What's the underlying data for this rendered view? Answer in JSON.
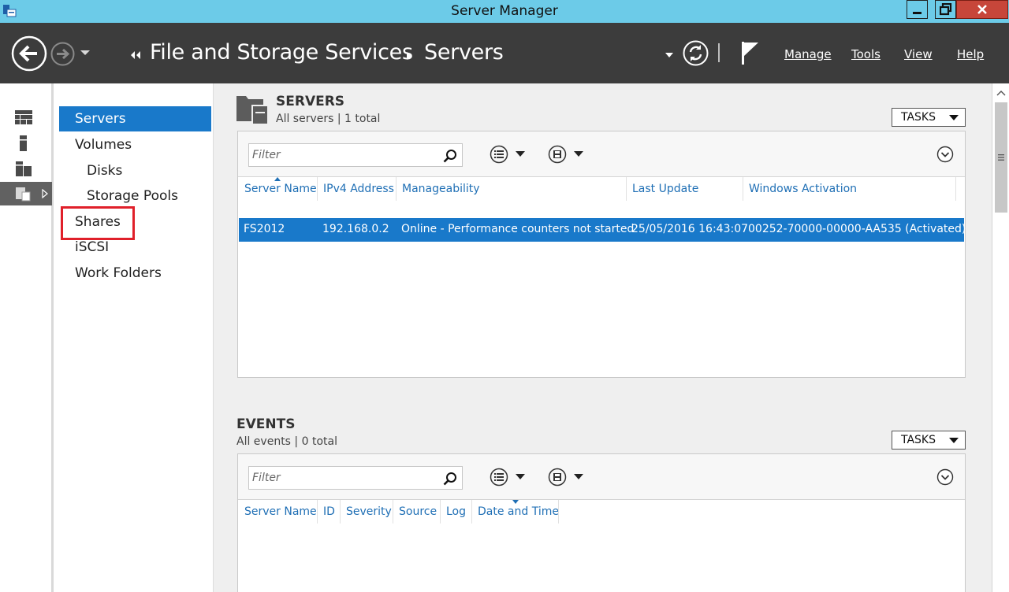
{
  "window": {
    "title": "Server Manager",
    "controls": {
      "minimize": "minimize",
      "maximize": "restore",
      "close": "close"
    }
  },
  "header": {
    "breadcrumb": [
      "File and Storage Services",
      "Servers"
    ],
    "menus": [
      {
        "label": "Manage"
      },
      {
        "label": "Tools"
      },
      {
        "label": "View"
      },
      {
        "label": "Help"
      }
    ]
  },
  "strip": {
    "items": [
      {
        "icon": "dashboard-icon"
      },
      {
        "icon": "local-server-icon"
      },
      {
        "icon": "all-servers-icon"
      },
      {
        "icon": "file-storage-icon",
        "active": true
      }
    ]
  },
  "nav": {
    "items": [
      {
        "label": "Servers",
        "selected": true
      },
      {
        "label": "Volumes"
      },
      {
        "label": "Disks"
      },
      {
        "label": "Storage Pools"
      },
      {
        "label": "Shares",
        "highlighted": true
      },
      {
        "label": "iSCSI"
      },
      {
        "label": "Work Folders"
      }
    ]
  },
  "servers": {
    "title": "SERVERS",
    "subtitle": "All servers | 1 total",
    "tasks_label": "TASKS",
    "filter_placeholder": "Filter",
    "columns": [
      "Server Name",
      "IPv4 Address",
      "Manageability",
      "Last Update",
      "Windows Activation"
    ],
    "rows": [
      {
        "server_name": "FS2012",
        "ipv4": "192.168.0.2",
        "manageability": "Online - Performance counters not started",
        "last_update": "25/05/2016 16:43:07",
        "activation": "00252-70000-00000-AA535 (Activated)",
        "selected": true
      }
    ]
  },
  "events": {
    "title": "EVENTS",
    "subtitle": "All events | 0 total",
    "tasks_label": "TASKS",
    "filter_placeholder": "Filter",
    "columns": [
      "Server Name",
      "ID",
      "Severity",
      "Source",
      "Log",
      "Date and Time"
    ]
  },
  "colors": {
    "titlebar": "#6ccbe8",
    "header": "#3c3c3c",
    "selection": "#1979ca",
    "link": "#1f6fb5",
    "highlight_box": "#e0202a"
  }
}
